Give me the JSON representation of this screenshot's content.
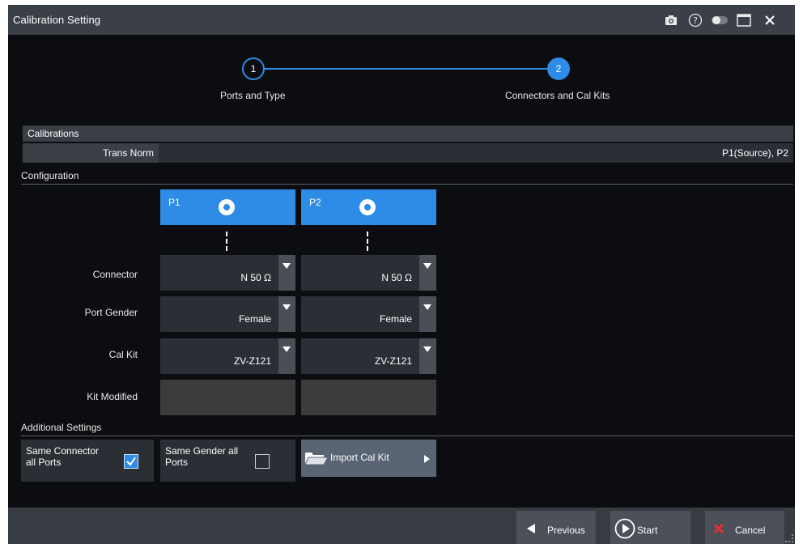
{
  "window": {
    "title": "Calibration Setting",
    "icons": [
      "camera-icon",
      "help-icon",
      "toggle-icon",
      "maximize-icon",
      "close-icon"
    ]
  },
  "wizard": {
    "steps": [
      {
        "number": "1",
        "label": "Ports and Type",
        "state": "done"
      },
      {
        "number": "2",
        "label": "Connectors and Cal Kits",
        "state": "active"
      }
    ]
  },
  "calibrations": {
    "header": "Calibrations",
    "rows": [
      {
        "name": "Trans Norm",
        "value": "P1(Source), P2"
      }
    ]
  },
  "configuration": {
    "title": "Configuration",
    "ports": [
      {
        "label": "P1",
        "connector": "N 50 Ω",
        "gender": "Female",
        "cal_kit": "ZV-Z121",
        "kit_modified": ""
      },
      {
        "label": "P2",
        "connector": "N 50 Ω",
        "gender": "Female",
        "cal_kit": "ZV-Z121",
        "kit_modified": ""
      }
    ],
    "row_labels": {
      "connector": "Connector",
      "gender": "Port Gender",
      "cal_kit": "Cal Kit",
      "kit_modified": "Kit Modified"
    }
  },
  "additional": {
    "title": "Additional Settings",
    "same_connector": {
      "line1": "Same Connector",
      "line2": "all Ports",
      "checked": true
    },
    "same_gender": {
      "line1": "Same Gender all",
      "line2": "Ports",
      "checked": false
    },
    "import_label": "Import Cal Kit"
  },
  "footer": {
    "previous": "Previous",
    "start": "Start",
    "cancel": "Cancel"
  },
  "colors": {
    "accent": "#2e8be6",
    "background": "#0c0d10",
    "cancel_x": "#e53030"
  }
}
